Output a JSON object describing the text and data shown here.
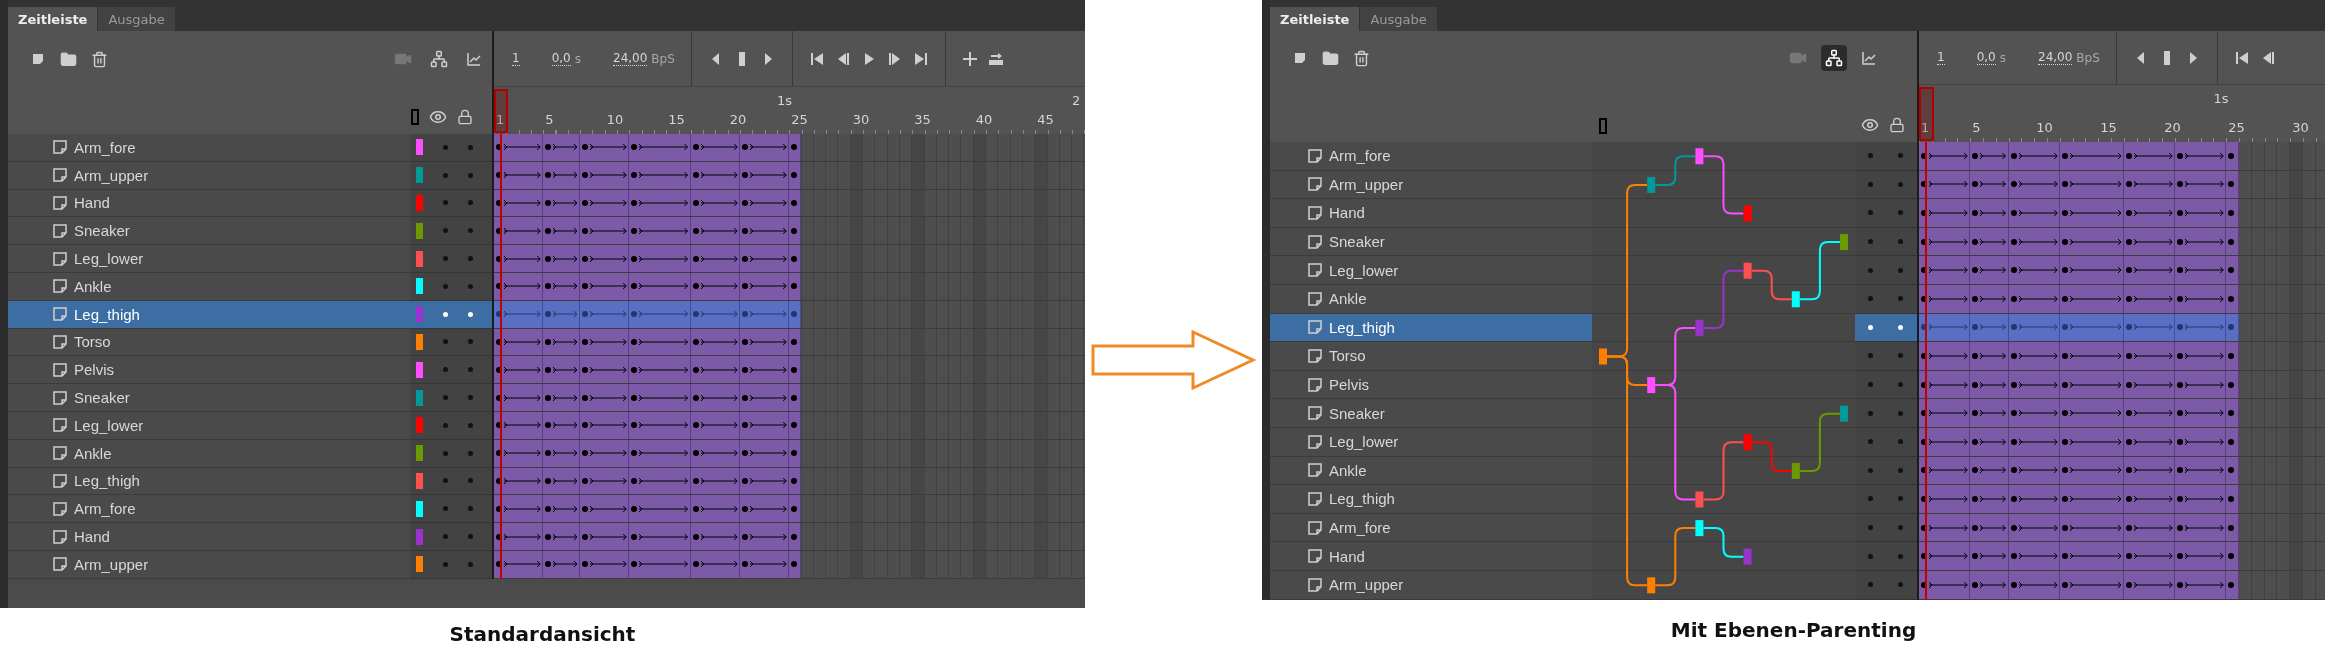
{
  "panels": [
    {
      "kind": "standard",
      "tabs": [
        {
          "label": "Zeitleiste",
          "selected": true
        },
        {
          "label": "Ausgabe",
          "selected": false
        }
      ],
      "toolbar": {
        "layer_parenting_selected": false,
        "frame": "1",
        "time": "0,0",
        "time_unit": "s",
        "rate": "24,00",
        "rate_unit": "BpS"
      },
      "ruler": {
        "seconds": [
          "1s",
          "2"
        ],
        "frames": [
          "1",
          "5",
          "10",
          "15",
          "20",
          "25",
          "30",
          "35",
          "40",
          "45"
        ]
      },
      "layers": [
        {
          "name": "Arm_fore",
          "color": "#ff4dff",
          "selected": false
        },
        {
          "name": "Arm_upper",
          "color": "#009a9a",
          "selected": false
        },
        {
          "name": "Hand",
          "color": "#ff0000",
          "selected": false
        },
        {
          "name": "Sneaker",
          "color": "#6b9900",
          "selected": false
        },
        {
          "name": "Leg_lower",
          "color": "#ff5050",
          "selected": false
        },
        {
          "name": "Ankle",
          "color": "#00ffff",
          "selected": false
        },
        {
          "name": "Leg_thigh",
          "color": "#9933cc",
          "selected": true
        },
        {
          "name": "Torso",
          "color": "#ff8000",
          "selected": false
        },
        {
          "name": "Pelvis",
          "color": "#ff4dff",
          "selected": false
        },
        {
          "name": "Sneaker",
          "color": "#009a9a",
          "selected": false
        },
        {
          "name": "Leg_lower",
          "color": "#ff0000",
          "selected": false
        },
        {
          "name": "Ankle",
          "color": "#6b9900",
          "selected": false
        },
        {
          "name": "Leg_thigh",
          "color": "#ff5050",
          "selected": false
        },
        {
          "name": "Arm_fore",
          "color": "#00ffff",
          "selected": false
        },
        {
          "name": "Hand",
          "color": "#9933cc",
          "selected": false
        },
        {
          "name": "Arm_upper",
          "color": "#ff8000",
          "selected": false
        }
      ],
      "caption": "Standardansicht"
    },
    {
      "kind": "parenting",
      "tabs": [
        {
          "label": "Zeitleiste",
          "selected": true
        },
        {
          "label": "Ausgabe",
          "selected": false
        }
      ],
      "toolbar": {
        "layer_parenting_selected": true,
        "frame": "1",
        "time": "0,0",
        "time_unit": "s",
        "rate": "24,00",
        "rate_unit": "BpS"
      },
      "ruler": {
        "seconds": [
          "1s"
        ],
        "frames": [
          "1",
          "5",
          "10",
          "15",
          "20",
          "25",
          "30"
        ]
      },
      "layers": [
        {
          "name": "Arm_fore",
          "color": "#ff4dff",
          "selected": false
        },
        {
          "name": "Arm_upper",
          "color": "#009a9a",
          "selected": false
        },
        {
          "name": "Hand",
          "color": "#ff0000",
          "selected": false
        },
        {
          "name": "Sneaker",
          "color": "#6b9900",
          "selected": false
        },
        {
          "name": "Leg_lower",
          "color": "#ff5050",
          "selected": false
        },
        {
          "name": "Ankle",
          "color": "#00ffff",
          "selected": false
        },
        {
          "name": "Leg_thigh",
          "color": "#9933cc",
          "selected": true
        },
        {
          "name": "Torso",
          "color": "#ff8000",
          "selected": false
        },
        {
          "name": "Pelvis",
          "color": "#ff4dff",
          "selected": false
        },
        {
          "name": "Sneaker",
          "color": "#009a9a",
          "selected": false
        },
        {
          "name": "Leg_lower",
          "color": "#ff0000",
          "selected": false
        },
        {
          "name": "Ankle",
          "color": "#6b9900",
          "selected": false
        },
        {
          "name": "Leg_thigh",
          "color": "#ff5050",
          "selected": false
        },
        {
          "name": "Arm_fore",
          "color": "#00ffff",
          "selected": false
        },
        {
          "name": "Hand",
          "color": "#9933cc",
          "selected": false
        },
        {
          "name": "Arm_upper",
          "color": "#ff8000",
          "selected": false
        }
      ],
      "caption": "Mit Ebenen-Parenting"
    }
  ]
}
